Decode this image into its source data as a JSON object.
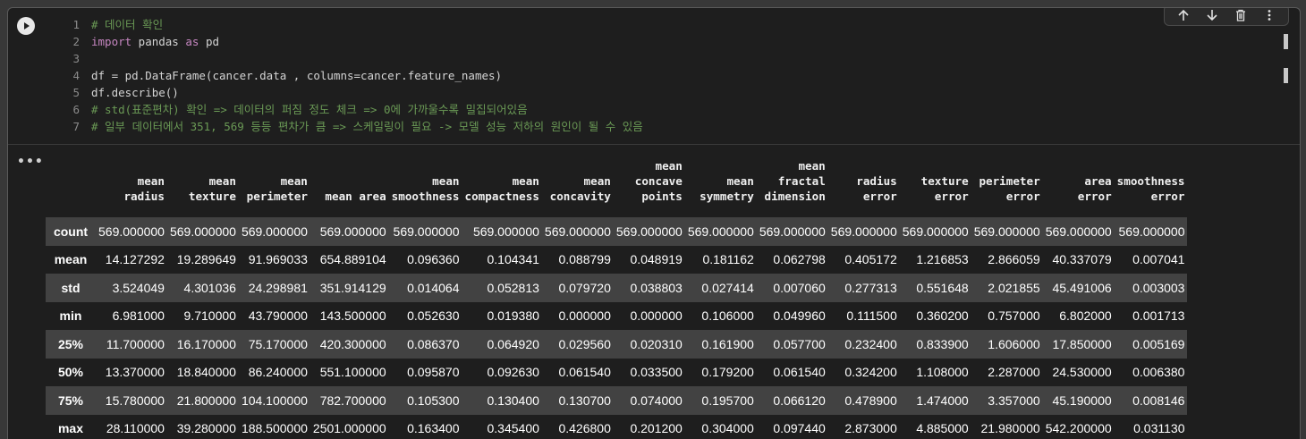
{
  "toolbar": {
    "icons": [
      "arrow-up-icon",
      "arrow-down-icon",
      "trash-icon",
      "more-vert-icon"
    ]
  },
  "code_lines": [
    {
      "num": "1",
      "tokens": [
        {
          "t": "cm",
          "s": "# 데이터 확인"
        }
      ]
    },
    {
      "num": "2",
      "tokens": [
        {
          "t": "kw",
          "s": "import"
        },
        {
          "t": "tx",
          "s": " pandas "
        },
        {
          "t": "kw",
          "s": "as"
        },
        {
          "t": "tx",
          "s": " pd"
        }
      ]
    },
    {
      "num": "3",
      "tokens": []
    },
    {
      "num": "4",
      "tokens": [
        {
          "t": "tx",
          "s": "df = pd.DataFrame(cancer.data , columns=cancer.feature_names)"
        }
      ]
    },
    {
      "num": "5",
      "tokens": [
        {
          "t": "tx",
          "s": "df.describe()"
        }
      ]
    },
    {
      "num": "6",
      "tokens": [
        {
          "t": "cm",
          "s": "# std(표준편차) 확인 => 데이터의 퍼짐 정도 체크 => 0에 가까울수록 밀집되어있음"
        }
      ]
    },
    {
      "num": "7",
      "tokens": [
        {
          "t": "cm",
          "s": "# 일부 데이터에서 351, 569 등등 편차가 큼 => 스케일링이 필요 -> 모델 성능 저하의 원인이 될 수 있음"
        }
      ]
    }
  ],
  "output_menu": "•••",
  "table": {
    "columns": [
      "mean\nradius",
      "mean\ntexture",
      "mean\nperimeter",
      "mean area",
      "mean\nsmoothness",
      "mean\ncompactness",
      "mean\nconcavity",
      "mean\nconcave\npoints",
      "mean\nsymmetry",
      "mean\nfractal\ndimension",
      "radius\nerror",
      "texture\nerror",
      "perimeter\nerror",
      "area\nerror",
      "smoothness\nerror"
    ],
    "rows": [
      {
        "label": "count",
        "values": [
          "569.000000",
          "569.000000",
          "569.000000",
          "569.000000",
          "569.000000",
          "569.000000",
          "569.000000",
          "569.000000",
          "569.000000",
          "569.000000",
          "569.000000",
          "569.000000",
          "569.000000",
          "569.000000",
          "569.000000"
        ]
      },
      {
        "label": "mean",
        "values": [
          "14.127292",
          "19.289649",
          "91.969033",
          "654.889104",
          "0.096360",
          "0.104341",
          "0.088799",
          "0.048919",
          "0.181162",
          "0.062798",
          "0.405172",
          "1.216853",
          "2.866059",
          "40.337079",
          "0.007041"
        ]
      },
      {
        "label": "std",
        "values": [
          "3.524049",
          "4.301036",
          "24.298981",
          "351.914129",
          "0.014064",
          "0.052813",
          "0.079720",
          "0.038803",
          "0.027414",
          "0.007060",
          "0.277313",
          "0.551648",
          "2.021855",
          "45.491006",
          "0.003003"
        ]
      },
      {
        "label": "min",
        "values": [
          "6.981000",
          "9.710000",
          "43.790000",
          "143.500000",
          "0.052630",
          "0.019380",
          "0.000000",
          "0.000000",
          "0.106000",
          "0.049960",
          "0.111500",
          "0.360200",
          "0.757000",
          "6.802000",
          "0.001713"
        ]
      },
      {
        "label": "25%",
        "values": [
          "11.700000",
          "16.170000",
          "75.170000",
          "420.300000",
          "0.086370",
          "0.064920",
          "0.029560",
          "0.020310",
          "0.161900",
          "0.057700",
          "0.232400",
          "0.833900",
          "1.606000",
          "17.850000",
          "0.005169"
        ]
      },
      {
        "label": "50%",
        "values": [
          "13.370000",
          "18.840000",
          "86.240000",
          "551.100000",
          "0.095870",
          "0.092630",
          "0.061540",
          "0.033500",
          "0.179200",
          "0.061540",
          "0.324200",
          "1.108000",
          "2.287000",
          "24.530000",
          "0.006380"
        ]
      },
      {
        "label": "75%",
        "values": [
          "15.780000",
          "21.800000",
          "104.100000",
          "782.700000",
          "0.105300",
          "0.130400",
          "0.130700",
          "0.074000",
          "0.195700",
          "0.066120",
          "0.478900",
          "1.474000",
          "3.357000",
          "45.190000",
          "0.008146"
        ]
      },
      {
        "label": "max",
        "values": [
          "28.110000",
          "39.280000",
          "188.500000",
          "2501.000000",
          "0.163400",
          "0.345400",
          "0.426800",
          "0.201200",
          "0.304000",
          "0.097440",
          "2.873000",
          "4.885000",
          "21.980000",
          "542.200000",
          "0.031130"
        ]
      }
    ]
  }
}
